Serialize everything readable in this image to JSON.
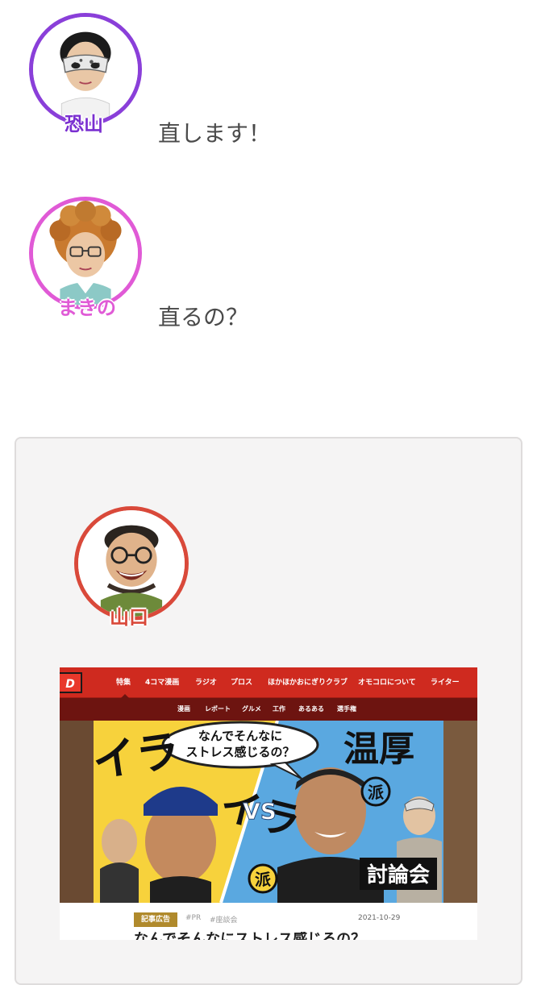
{
  "conversation": [
    {
      "speaker": "恐山",
      "text": "直します！",
      "ring_color": "#8a3fd9"
    },
    {
      "speaker": "まきの",
      "text": "直るの？",
      "ring_color": "#e05ad6"
    }
  ],
  "card": {
    "speaker": "山口",
    "ring_color": "#d9493a",
    "embedded_page": {
      "logo": "D",
      "nav": [
        "特集",
        "4コマ漫画",
        "ラジオ",
        "プロス",
        "ほかほかおにぎりクラブ",
        "オモコロについて",
        "ライター"
      ],
      "subnav": [
        "漫画",
        "レポート",
        "グルメ",
        "工作",
        "あるある",
        "選手権"
      ],
      "hero": {
        "bubble_line1": "なんでそんなに",
        "bubble_line2": "ストレス感じるの？",
        "left_big": "イラ",
        "left_big2": "イラ",
        "left_ha": "派",
        "vs": "VS",
        "right_big": "温厚",
        "right_ha": "派",
        "debate": "討論会"
      },
      "badge": "記事広告",
      "tags": [
        "#PR",
        "#座談会"
      ],
      "date": "2021-10-29",
      "headline": "なんでそんなにストレス感じるの？"
    }
  },
  "colors": {
    "accent_red": "#cf2a1f",
    "dark_red": "#6d1410",
    "yellow": "#f7d23c",
    "blue": "#5aa8e0"
  }
}
